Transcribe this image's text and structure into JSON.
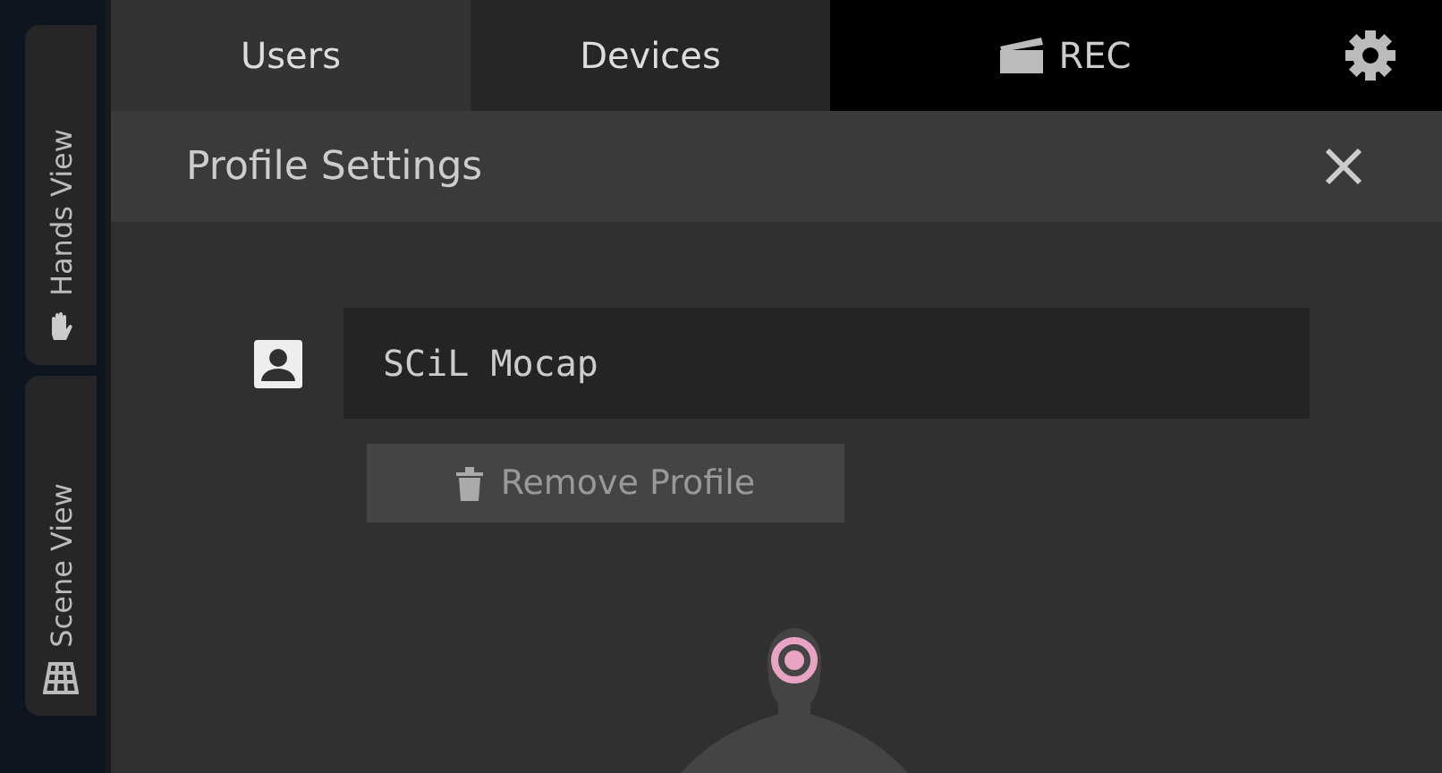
{
  "side_tabs": [
    {
      "label": "Hands View",
      "kind": "hand"
    },
    {
      "label": "Scene View",
      "kind": "grid"
    }
  ],
  "tabs": [
    {
      "label": "Users",
      "selected": true
    },
    {
      "label": "Devices",
      "selected": false
    }
  ],
  "record": {
    "label": "REC"
  },
  "panel": {
    "title": "Profile Settings",
    "profile_name": "SCiL Mocap",
    "remove_button": "Remove Profile"
  }
}
